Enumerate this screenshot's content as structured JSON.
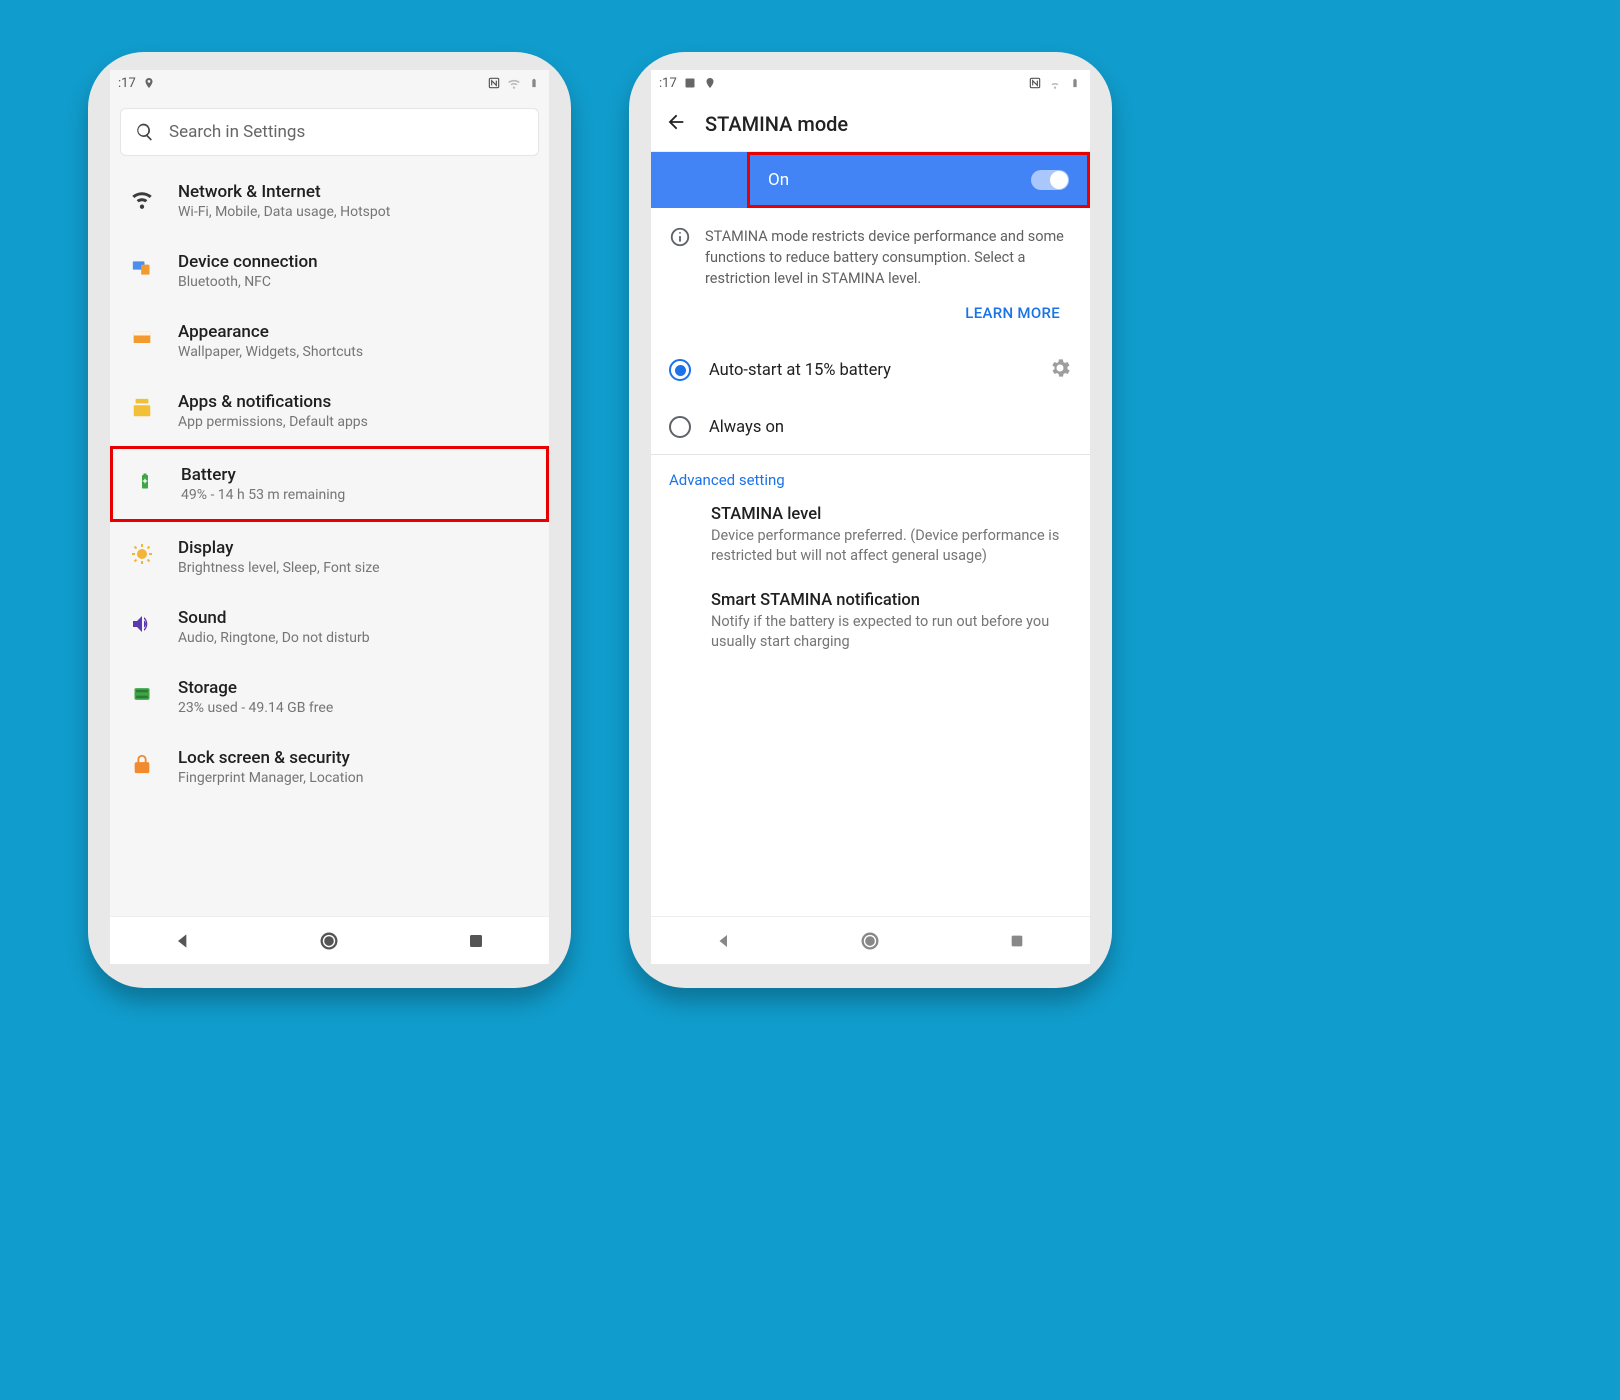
{
  "statusbar": {
    "time": ":17"
  },
  "phone_left": {
    "search_placeholder": "Search in Settings",
    "items": [
      {
        "title": "Network & Internet",
        "sub": "Wi-Fi, Mobile, Data usage, Hotspot"
      },
      {
        "title": "Device connection",
        "sub": "Bluetooth, NFC"
      },
      {
        "title": "Appearance",
        "sub": "Wallpaper, Widgets, Shortcuts"
      },
      {
        "title": "Apps & notifications",
        "sub": "App permissions, Default apps"
      },
      {
        "title": "Battery",
        "sub": "49% - 14 h  53 m remaining"
      },
      {
        "title": "Display",
        "sub": "Brightness level, Sleep, Font size"
      },
      {
        "title": "Sound",
        "sub": "Audio, Ringtone, Do not disturb"
      },
      {
        "title": "Storage",
        "sub": "23% used - 49.14 GB free"
      },
      {
        "title": "Lock screen & security",
        "sub": "Fingerprint Manager, Location"
      }
    ]
  },
  "phone_right": {
    "header_title": "STAMINA mode",
    "toggle_label": "On",
    "info_text": "STAMINA mode restricts device performance and some functions to reduce battery consumption. Select a restriction level in STAMINA level.",
    "learn_more": "LEARN MORE",
    "radio_auto": "Auto-start at 15% battery",
    "radio_always": "Always on",
    "section_label": "Advanced setting",
    "adv": [
      {
        "title": "STAMINA level",
        "sub": "Device performance preferred. (Device performance is restricted but will not affect general usage)"
      },
      {
        "title": "Smart STAMINA notification",
        "sub": "Notify if the battery is expected to run out before you usually start charging"
      }
    ]
  }
}
